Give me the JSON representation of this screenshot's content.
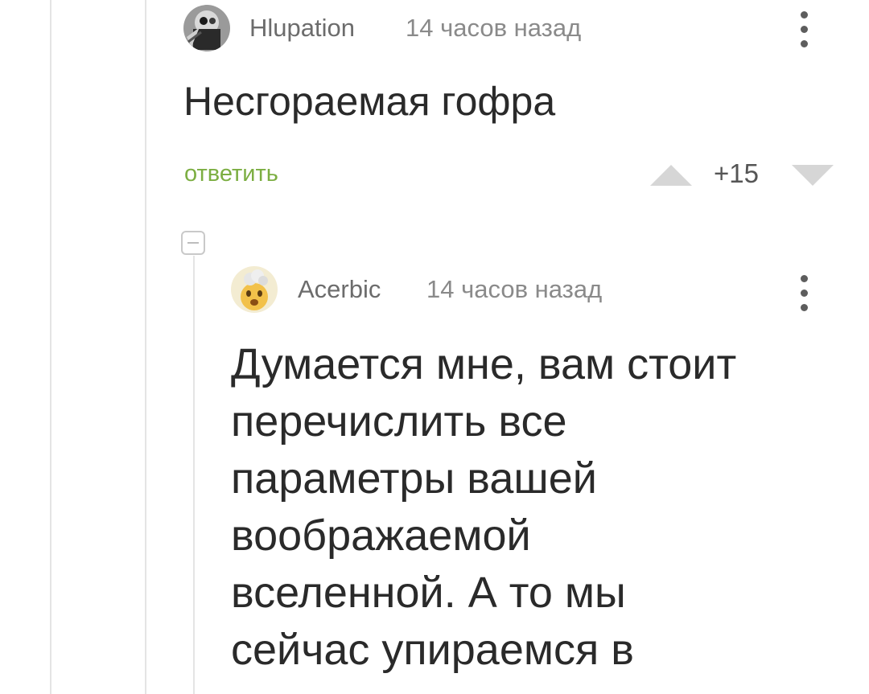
{
  "comments": [
    {
      "author": "Hlupation",
      "time": "14 часов назад",
      "text": "Несгораемая гофра",
      "reply_label": "ответить",
      "score": "+15"
    },
    {
      "author": "Acerbic",
      "time": "14 часов назад",
      "text_lines": [
        "Думается мне, вам стоит",
        "перечислить все",
        "параметры вашей",
        "воображаемой",
        "вселенной. А то мы",
        "сейчас упираемся в"
      ]
    }
  ],
  "colors": {
    "reply_green": "#7cae42",
    "thread_line": "#e4e4e4",
    "vote_arrow": "#d6d6d6"
  },
  "icons": [
    "kebab-menu-icon",
    "vote-up-icon",
    "vote-down-icon",
    "collapse-thread-icon"
  ]
}
